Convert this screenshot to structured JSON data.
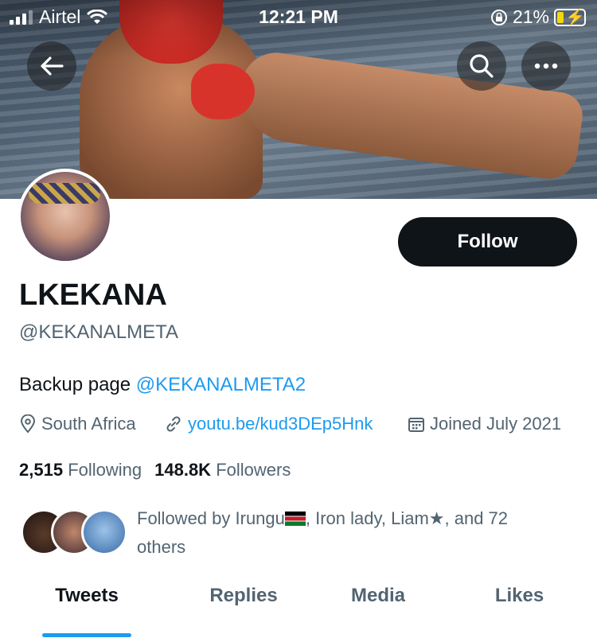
{
  "status_bar": {
    "carrier": "Airtel",
    "time": "12:21 PM",
    "battery": "21%"
  },
  "header": {
    "back_icon": "arrow-left-icon",
    "search_icon": "search-icon",
    "more_icon": "more-icon"
  },
  "profile": {
    "name": "LKEKANA",
    "handle": "@KEKANALMETA",
    "bio_text": "Backup page ",
    "bio_mention": "@KEKANALMETA2",
    "location": "South Africa",
    "website": "youtu.be/kud3DEp5Hnk",
    "joined": "Joined July 2021",
    "following_count": "2,515",
    "following_label": "Following",
    "followers_count": "148.8K",
    "followers_label": "Followers",
    "follow_button": "Follow"
  },
  "followed_by": {
    "prefix": "Followed by Irungu",
    "rest": ", Iron lady, Liam★, and 72 others"
  },
  "tabs": [
    {
      "label": "Tweets",
      "active": true
    },
    {
      "label": "Replies",
      "active": false
    },
    {
      "label": "Media",
      "active": false
    },
    {
      "label": "Likes",
      "active": false
    }
  ],
  "colors": {
    "accent": "#1d9bf0",
    "text_primary": "#0f1419",
    "text_secondary": "#536471",
    "button_bg": "#0f1419"
  }
}
